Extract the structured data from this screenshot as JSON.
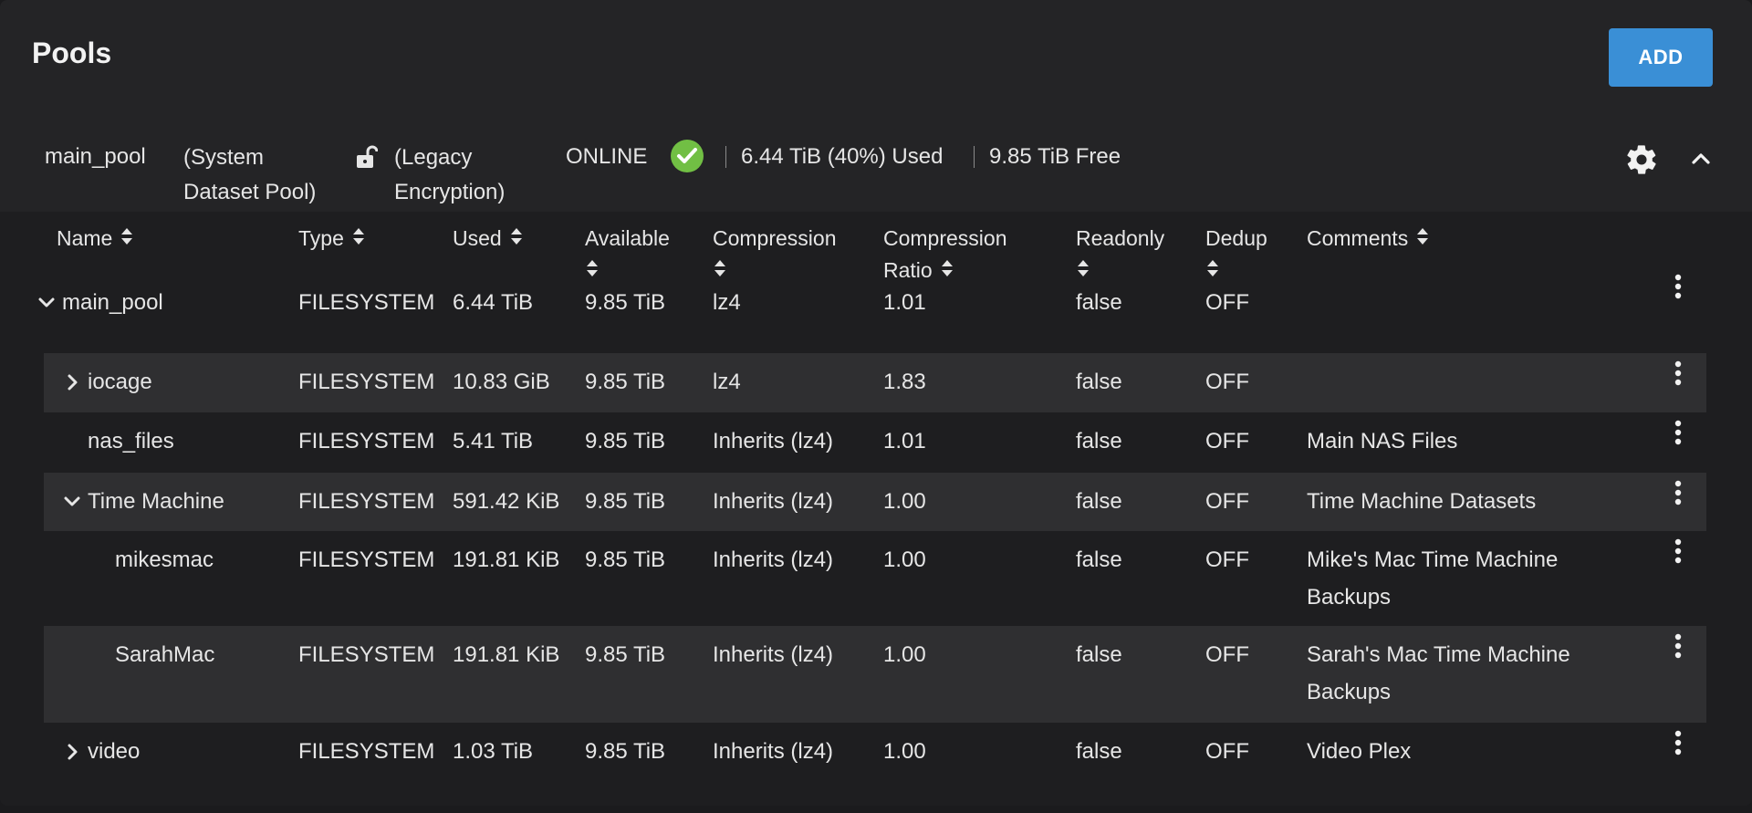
{
  "header": {
    "title": "Pools",
    "add_label": "ADD"
  },
  "pool": {
    "name": "main_pool",
    "system_label": "(System\nDataset Pool)",
    "encryption_label": "(Legacy\nEncryption)",
    "status": "ONLINE",
    "used": "6.44 TiB (40%) Used",
    "free": "9.85 TiB Free"
  },
  "columns": [
    {
      "line1": "Name",
      "line2": ""
    },
    {
      "line1": "Type",
      "line2": ""
    },
    {
      "line1": "Used",
      "line2": ""
    },
    {
      "line1": "Available",
      "line2": ""
    },
    {
      "line1": "Compression",
      "line2": ""
    },
    {
      "line1": "Compression",
      "line2": "Ratio"
    },
    {
      "line1": "Readonly",
      "line2": ""
    },
    {
      "line1": "Dedup",
      "line2": ""
    },
    {
      "line1": "Comments",
      "line2": ""
    }
  ],
  "rows": [
    {
      "name": "main_pool",
      "type": "FILESYSTEM",
      "used": "6.44 TiB",
      "available": "9.85 TiB",
      "compression": "lz4",
      "ratio": "1.01",
      "readonly": "false",
      "dedup": "OFF",
      "comment1": "",
      "comment2": "",
      "expander": "expanded"
    },
    {
      "name": "iocage",
      "type": "FILESYSTEM",
      "used": "10.83 GiB",
      "available": "9.85 TiB",
      "compression": "lz4",
      "ratio": "1.83",
      "readonly": "false",
      "dedup": "OFF",
      "comment1": "",
      "comment2": "",
      "expander": "collapsed"
    },
    {
      "name": "nas_files",
      "type": "FILESYSTEM",
      "used": "5.41 TiB",
      "available": "9.85 TiB",
      "compression": "Inherits (lz4)",
      "ratio": "1.01",
      "readonly": "false",
      "dedup": "OFF",
      "comment1": "Main NAS Files",
      "comment2": "",
      "expander": "none"
    },
    {
      "name": "Time Machine",
      "type": "FILESYSTEM",
      "used": "591.42 KiB",
      "available": "9.85 TiB",
      "compression": "Inherits (lz4)",
      "ratio": "1.00",
      "readonly": "false",
      "dedup": "OFF",
      "comment1": "Time Machine Datasets",
      "comment2": "",
      "expander": "expanded"
    },
    {
      "name": "mikesmac",
      "type": "FILESYSTEM",
      "used": "191.81 KiB",
      "available": "9.85 TiB",
      "compression": "Inherits (lz4)",
      "ratio": "1.00",
      "readonly": "false",
      "dedup": "OFF",
      "comment1": "Mike's Mac Time Machine",
      "comment2": "Backups",
      "expander": "none"
    },
    {
      "name": "SarahMac",
      "type": "FILESYSTEM",
      "used": "191.81 KiB",
      "available": "9.85 TiB",
      "compression": "Inherits (lz4)",
      "ratio": "1.00",
      "readonly": "false",
      "dedup": "OFF",
      "comment1": "Sarah's Mac Time Machine",
      "comment2": "Backups",
      "expander": "none"
    },
    {
      "name": "video",
      "type": "FILESYSTEM",
      "used": "1.03 TiB",
      "available": "9.85 TiB",
      "compression": "Inherits (lz4)",
      "ratio": "1.00",
      "readonly": "false",
      "dedup": "OFF",
      "comment1": "Video Plex",
      "comment2": "",
      "expander": "collapsed"
    }
  ],
  "icons": {
    "lock": "lock-open-icon",
    "status": "check-circle-icon",
    "settings": "gear-icon",
    "collapse": "chevron-up-icon",
    "row_actions": "more-vert-icon",
    "sort": "sort-icon"
  },
  "colors": {
    "accent": "#3a8fd6",
    "status_ok": "#71bf44"
  }
}
